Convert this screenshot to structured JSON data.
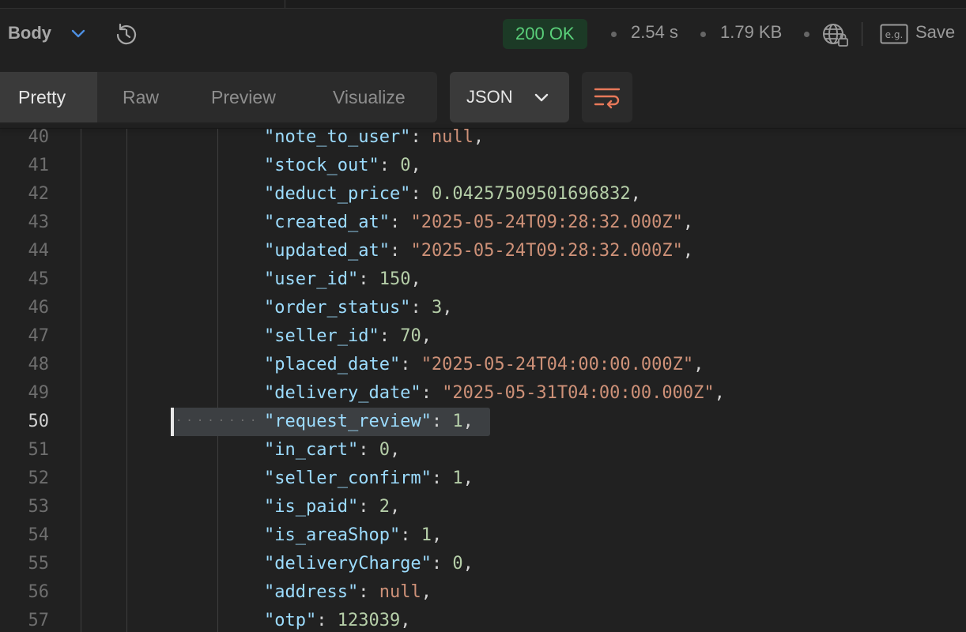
{
  "response_bar": {
    "body_label": "Body",
    "status": "200 OK",
    "time": "2.54 s",
    "size": "1.79 KB",
    "save_label": "Save",
    "icons": [
      "chevron-down-icon",
      "history-icon",
      "globe-lock-icon",
      "example-icon"
    ]
  },
  "view_tabs": [
    {
      "label": "Pretty"
    },
    {
      "label": "Raw"
    },
    {
      "label": "Preview"
    },
    {
      "label": "Visualize"
    }
  ],
  "format_select": {
    "value": "JSON"
  },
  "colors": {
    "status_bg": "#1c3a26",
    "status_fg": "#5ad07a",
    "key": "#9cdcfe",
    "number": "#b5cea8",
    "string": "#ce9178"
  },
  "editor": {
    "current_line": "50",
    "lines": [
      {
        "n": "40",
        "key": "\"note_to_user\"",
        "value": "null",
        "type": "null"
      },
      {
        "n": "41",
        "key": "\"stock_out\"",
        "value": "0",
        "type": "number"
      },
      {
        "n": "42",
        "key": "\"deduct_price\"",
        "value": "0.04257509501696832",
        "type": "number"
      },
      {
        "n": "43",
        "key": "\"created_at\"",
        "value": "\"2025-05-24T09:28:32.000Z\"",
        "type": "string"
      },
      {
        "n": "44",
        "key": "\"updated_at\"",
        "value": "\"2025-05-24T09:28:32.000Z\"",
        "type": "string"
      },
      {
        "n": "45",
        "key": "\"user_id\"",
        "value": "150",
        "type": "number"
      },
      {
        "n": "46",
        "key": "\"order_status\"",
        "value": "3",
        "type": "number"
      },
      {
        "n": "47",
        "key": "\"seller_id\"",
        "value": "70",
        "type": "number"
      },
      {
        "n": "48",
        "key": "\"placed_date\"",
        "value": "\"2025-05-24T04:00:00.000Z\"",
        "type": "string"
      },
      {
        "n": "49",
        "key": "\"delivery_date\"",
        "value": "\"2025-05-31T04:00:00.000Z\"",
        "type": "string"
      },
      {
        "n": "50",
        "key": "\"request_review\"",
        "value": "1",
        "type": "number"
      },
      {
        "n": "51",
        "key": "\"in_cart\"",
        "value": "0",
        "type": "number"
      },
      {
        "n": "52",
        "key": "\"seller_confirm\"",
        "value": "1",
        "type": "number"
      },
      {
        "n": "53",
        "key": "\"is_paid\"",
        "value": "2",
        "type": "number"
      },
      {
        "n": "54",
        "key": "\"is_areaShop\"",
        "value": "1",
        "type": "number"
      },
      {
        "n": "55",
        "key": "\"deliveryCharge\"",
        "value": "0",
        "type": "number"
      },
      {
        "n": "56",
        "key": "\"address\"",
        "value": "null",
        "type": "null"
      },
      {
        "n": "57",
        "key": "\"otp\"",
        "value": "123039",
        "type": "number"
      }
    ]
  }
}
